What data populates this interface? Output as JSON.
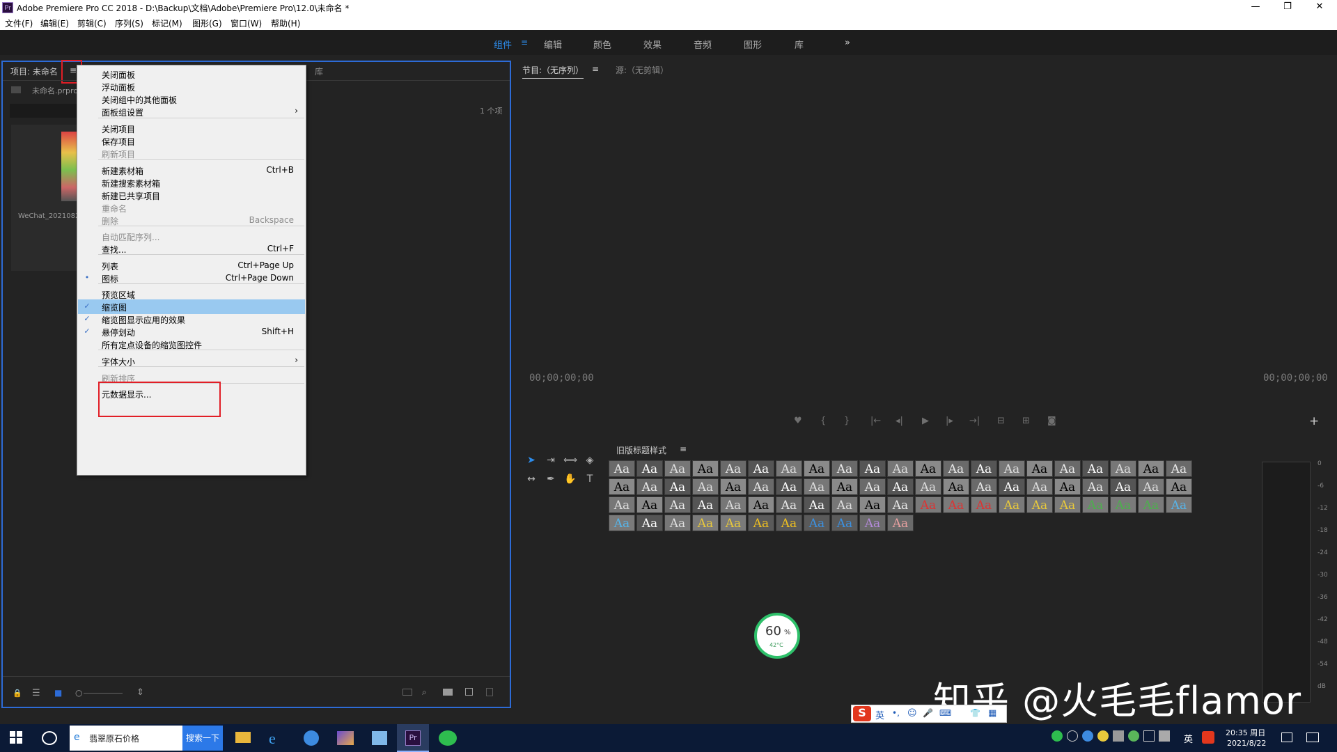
{
  "window": {
    "app_icon": "Pr",
    "title": "Adobe Premiere Pro CC 2018 - D:\\Backup\\文档\\Adobe\\Premiere Pro\\12.0\\未命名 *",
    "minimize": "—",
    "restore": "❐",
    "close": "✕"
  },
  "menubar": [
    "文件(F)",
    "编辑(E)",
    "剪辑(C)",
    "序列(S)",
    "标记(M)",
    "图形(G)",
    "窗口(W)",
    "帮助(H)"
  ],
  "workspaces": {
    "items": [
      "组件",
      "编辑",
      "颜色",
      "效果",
      "音频",
      "图形",
      "库"
    ],
    "active": "组件",
    "more": "»"
  },
  "project_panel": {
    "tab_label": "项目: 未命名",
    "menu_icon": "≡",
    "library_tab": "库",
    "file_name": "未命名.prpro",
    "item_count": "1 个项",
    "search_icon": "⌕",
    "clip_name": "WeChat_2021082"
  },
  "context_menu": {
    "items": [
      {
        "label": "关闭面板",
        "shortcut": "",
        "disabled": false
      },
      {
        "label": "浮动面板",
        "shortcut": "",
        "disabled": false
      },
      {
        "label": "关闭组中的其他面板",
        "shortcut": "",
        "disabled": false
      },
      {
        "label": "面板组设置",
        "shortcut": "",
        "disabled": false,
        "submenu": true
      },
      {
        "label": "关闭项目",
        "shortcut": "",
        "disabled": false
      },
      {
        "label": "保存项目",
        "shortcut": "",
        "disabled": false
      },
      {
        "label": "刷新项目",
        "shortcut": "",
        "disabled": true
      },
      {
        "label": "新建素材箱",
        "shortcut": "Ctrl+B",
        "disabled": false
      },
      {
        "label": "新建搜索素材箱",
        "shortcut": "",
        "disabled": false
      },
      {
        "label": "新建已共享项目",
        "shortcut": "",
        "disabled": false
      },
      {
        "label": "重命名",
        "shortcut": "",
        "disabled": true
      },
      {
        "label": "删除",
        "shortcut": "Backspace",
        "disabled": true
      },
      {
        "label": "自动匹配序列...",
        "shortcut": "",
        "disabled": true
      },
      {
        "label": "查找...",
        "shortcut": "Ctrl+F",
        "disabled": false
      },
      {
        "label": "列表",
        "shortcut": "Ctrl+Page Up",
        "disabled": false
      },
      {
        "label": "图标",
        "shortcut": "Ctrl+Page Down",
        "disabled": false,
        "mark": "•"
      },
      {
        "label": "预览区域",
        "shortcut": "",
        "disabled": false
      },
      {
        "label": "缩览图",
        "shortcut": "",
        "disabled": false,
        "mark": "✓",
        "highlighted": true
      },
      {
        "label": "缩览图显示应用的效果",
        "shortcut": "",
        "disabled": false,
        "mark": "✓"
      },
      {
        "label": "悬停划动",
        "shortcut": "Shift+H",
        "disabled": false,
        "mark": "✓"
      },
      {
        "label": "所有定点设备的缩览图控件",
        "shortcut": "",
        "disabled": false
      },
      {
        "label": "字体大小",
        "shortcut": "",
        "disabled": false,
        "submenu": true
      },
      {
        "label": "刷新排序",
        "shortcut": "",
        "disabled": true
      },
      {
        "label": "元数据显示...",
        "shortcut": "",
        "disabled": false
      }
    ],
    "submenu_arrow": "›"
  },
  "program_panel": {
    "tab_label": "节目:（无序列）",
    "menu_icon": "≡",
    "source_tab": "源:（无剪辑）",
    "timecode_left": "00;00;00;00",
    "timecode_right": "00;00;00;00",
    "add_button": "+"
  },
  "transport": [
    "♥",
    "{",
    "}",
    "|←",
    "◂|",
    "▶",
    "|▸",
    "→|",
    "⊟",
    "⊞",
    "◙"
  ],
  "tools": [
    "➤",
    "⇥",
    "⟺",
    "◈",
    "↔",
    "✒",
    "✋",
    "T"
  ],
  "styles_panel": {
    "tab_label": "旧版标题样式",
    "menu_icon": "≡",
    "swatch_text": "Aa"
  },
  "meter": {
    "scale": [
      "0",
      "-6",
      "-12",
      "-18",
      "-24",
      "-30",
      "-36",
      "-42",
      "-48",
      "-54",
      "dB"
    ]
  },
  "project_bottom": {
    "lock_icon": "🔒",
    "list_icon": "☰",
    "icon_view": "■",
    "zoom_slider_icon": "○",
    "sort_icon": "⇕"
  },
  "overlay": {
    "cpu_percent": "60",
    "percent_sign": "%",
    "temp": "42°C",
    "watermark": "知乎 @火毛毛flamor"
  },
  "ime_bar": [
    "英",
    "•,",
    "☺",
    "🎤",
    "⌨",
    "👕",
    "▦"
  ],
  "taskbar": {
    "search_text": "翡翠原石价格",
    "search_button": "搜索一下",
    "clock_time": "20:35 周日",
    "clock_date": "2021/8/22",
    "lang": "英"
  },
  "colors": {
    "accent": "#2d8ceb",
    "highlight_box": "#e11e26",
    "menu_highlight": "#99c9f0",
    "panel_bg": "#232323"
  }
}
